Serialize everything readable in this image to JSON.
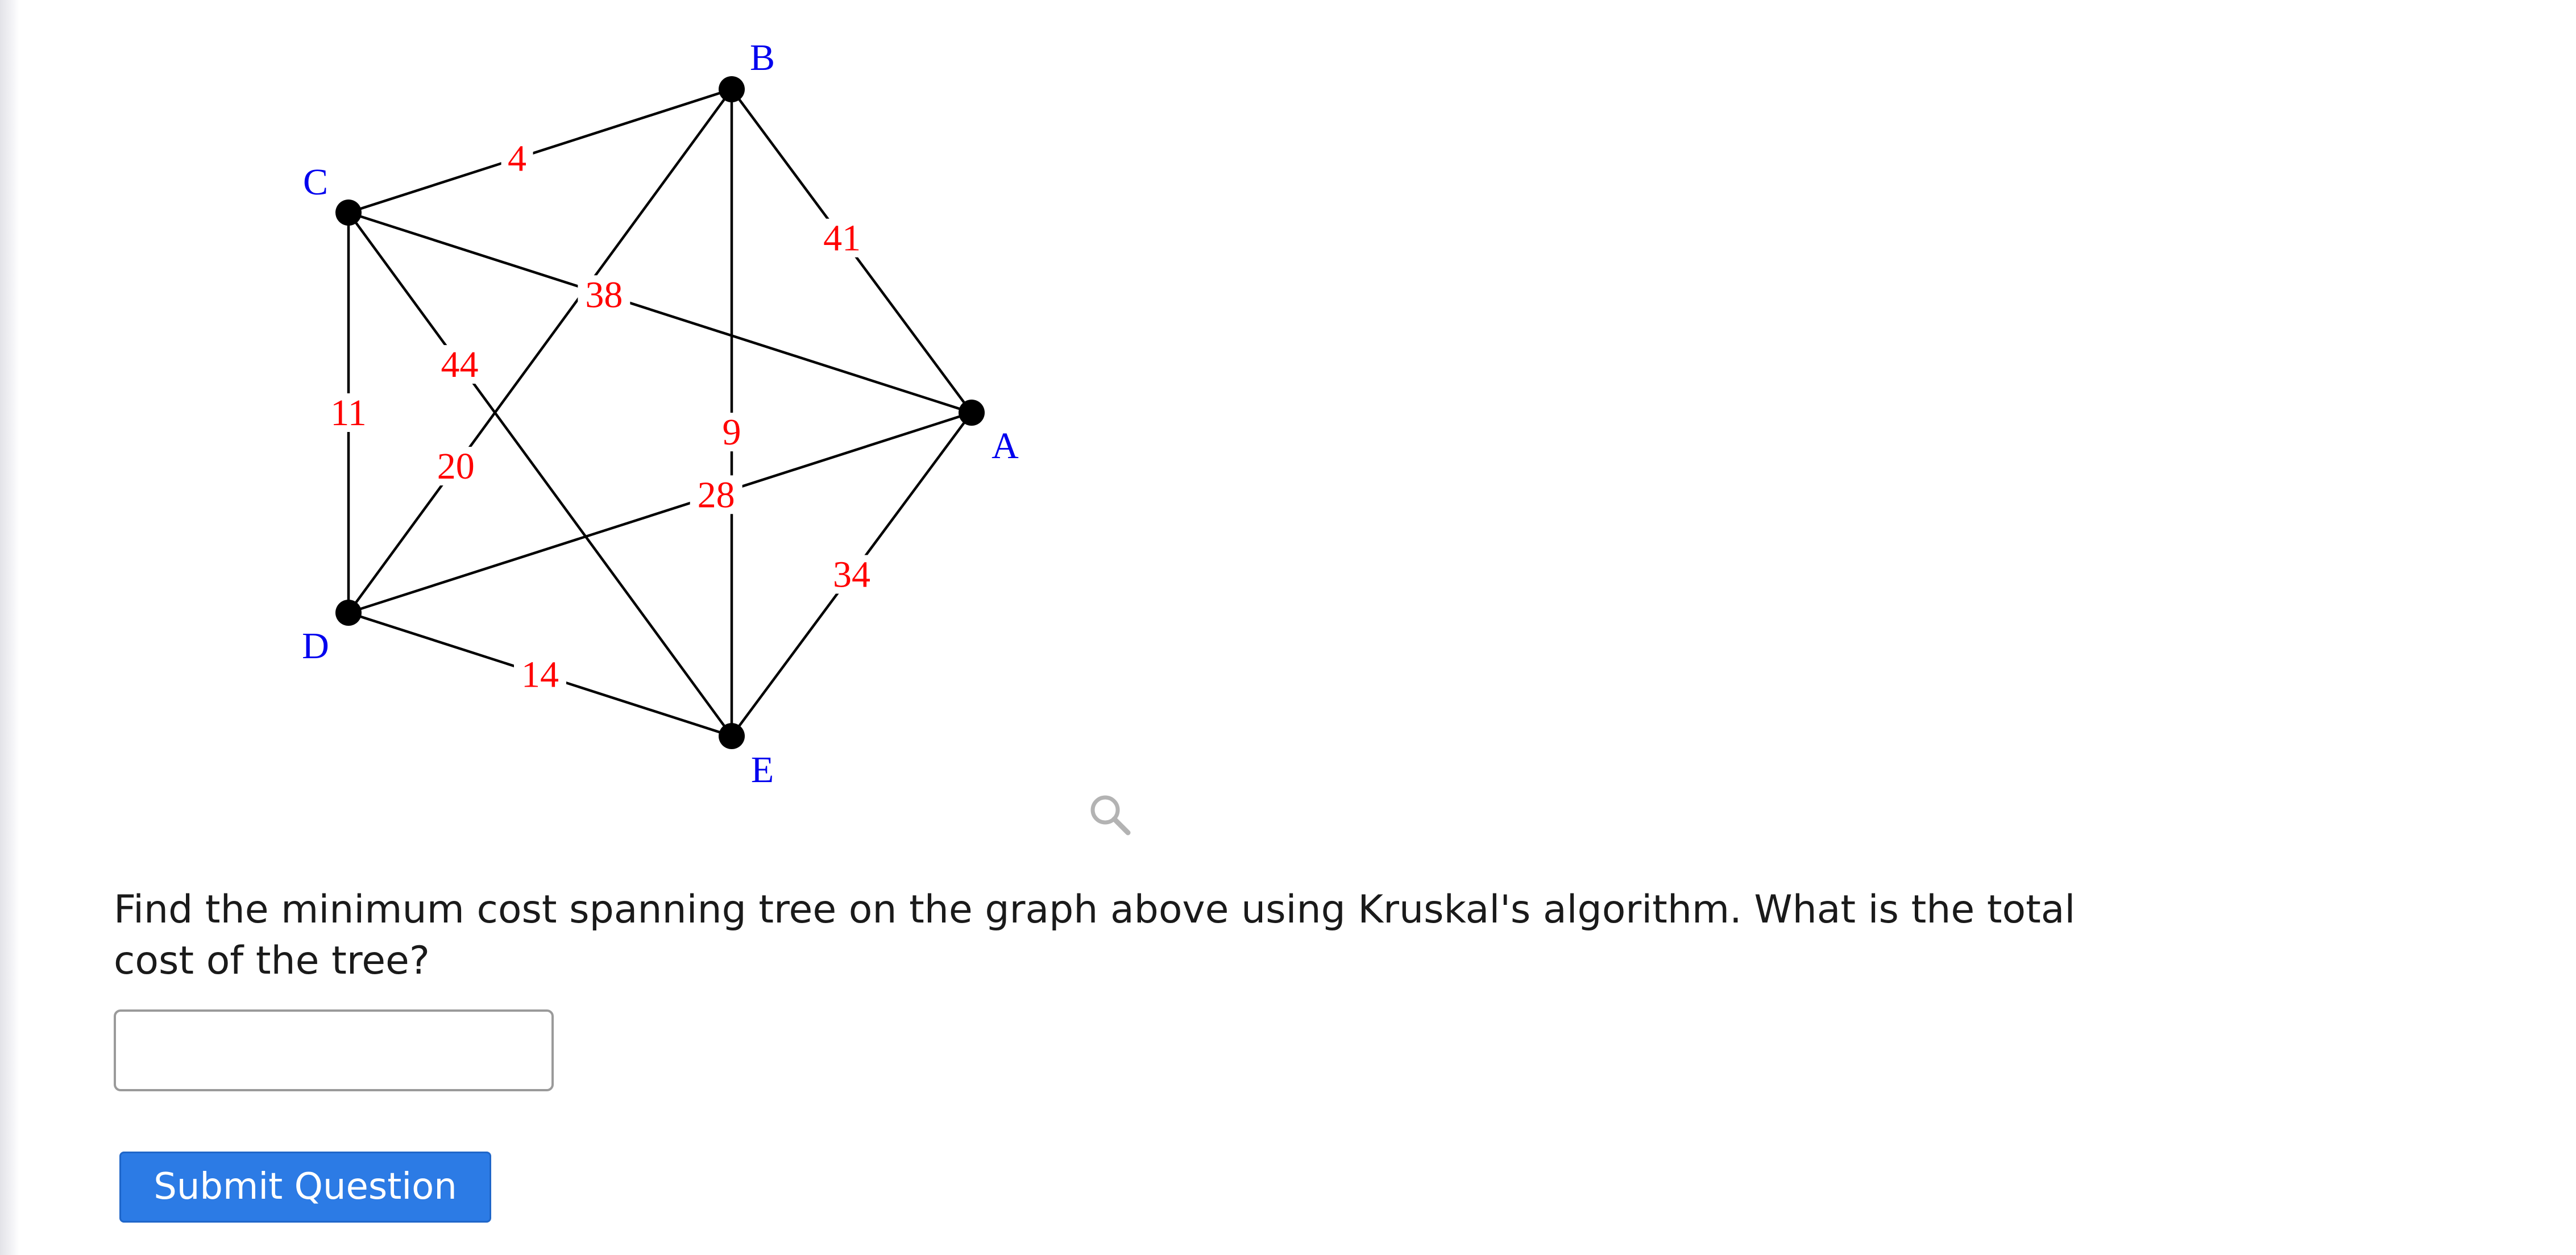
{
  "graph": {
    "vertices": [
      {
        "id": "A",
        "label": "A"
      },
      {
        "id": "B",
        "label": "B"
      },
      {
        "id": "C",
        "label": "C"
      },
      {
        "id": "D",
        "label": "D"
      },
      {
        "id": "E",
        "label": "E"
      }
    ],
    "edges": [
      {
        "from": "B",
        "to": "C",
        "weight": "4"
      },
      {
        "from": "B",
        "to": "A",
        "weight": "41"
      },
      {
        "from": "B",
        "to": "D",
        "weight": "20"
      },
      {
        "from": "B",
        "to": "E",
        "weight": "9"
      },
      {
        "from": "C",
        "to": "A",
        "weight": "38"
      },
      {
        "from": "C",
        "to": "D",
        "weight": "11"
      },
      {
        "from": "C",
        "to": "E",
        "weight": "44"
      },
      {
        "from": "D",
        "to": "A",
        "weight": "28"
      },
      {
        "from": "A",
        "to": "E",
        "weight": "34"
      },
      {
        "from": "D",
        "to": "E",
        "weight": "14"
      }
    ],
    "colors": {
      "edge": "#000000",
      "vertex": "#000000",
      "weight_label": "#ff0000",
      "vertex_label": "#0000ee"
    }
  },
  "zoom_icon": "magnifier-icon",
  "question": {
    "text": "Find the minimum cost spanning tree on the graph above using Kruskal's algorithm. What is the total cost of the tree?"
  },
  "answer": {
    "value": "",
    "placeholder": ""
  },
  "submit": {
    "label": "Submit Question",
    "color": "#2c7be5"
  }
}
